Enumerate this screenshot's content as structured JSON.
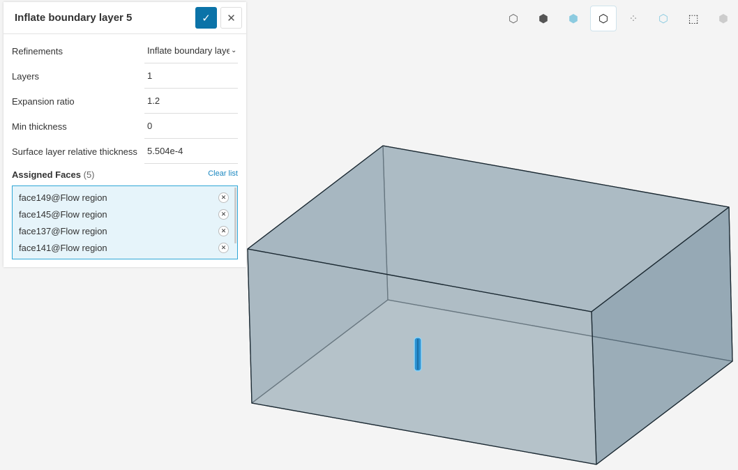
{
  "panel": {
    "title": "Inflate boundary layer 5",
    "fields": [
      {
        "label": "Refinements",
        "value": "Inflate boundary layer"
      },
      {
        "label": "Layers",
        "value": "1"
      },
      {
        "label": "Expansion ratio",
        "value": "1.2"
      },
      {
        "label": "Min thickness",
        "value": "0"
      },
      {
        "label": "Surface layer relative thickness",
        "value": "5.504e-4"
      }
    ],
    "assigned_label": "Assigned Faces",
    "assigned_count": "(5)",
    "clear": "Clear list",
    "faces": [
      "face149@Flow region",
      "face145@Flow region",
      "face137@Flow region",
      "face141@Flow region"
    ]
  },
  "toolbar": [
    "box-outline-icon",
    "box-solid-icon",
    "box-shaded-icon",
    "box-selected-icon",
    "box-vertices-icon",
    "box-edges-icon",
    "box-select-icon",
    "box-mesh-icon"
  ],
  "colors": {
    "accent": "#0b73a8",
    "box": "#8fa3b0"
  }
}
